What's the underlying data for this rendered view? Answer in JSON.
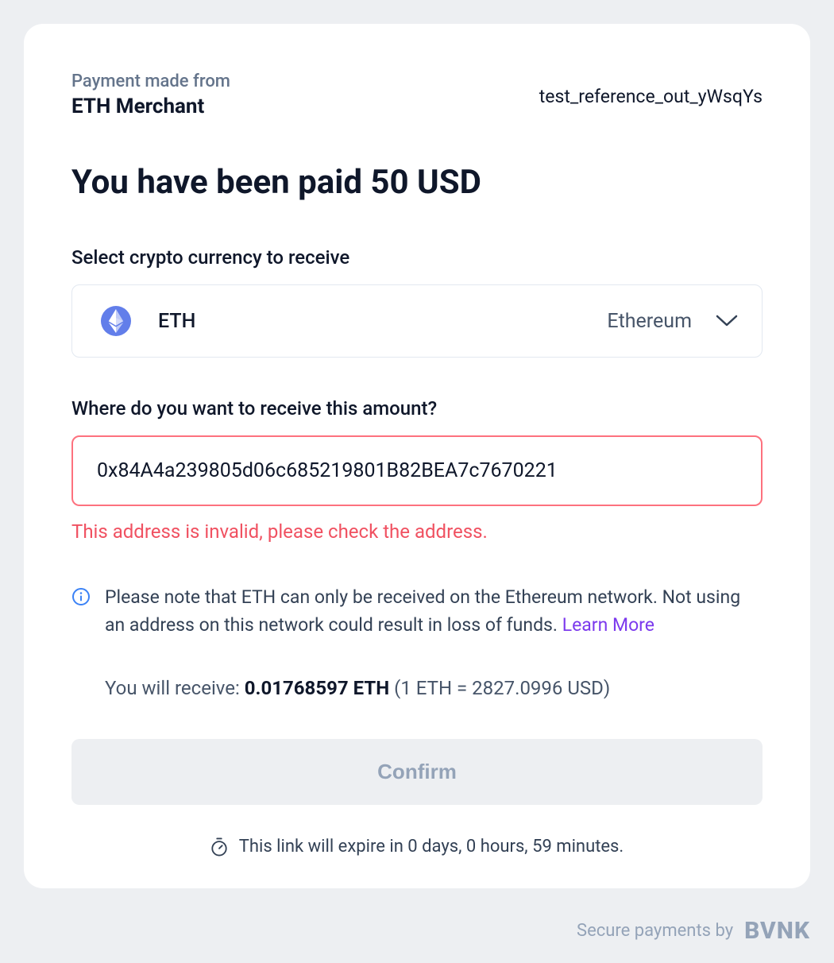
{
  "header": {
    "payment_from_label": "Payment made from",
    "merchant_name": "ETH Merchant",
    "reference": "test_reference_out_yWsqYs"
  },
  "title": "You have been paid 50 USD",
  "currency_select": {
    "label": "Select crypto currency to receive",
    "code": "ETH",
    "name": "Ethereum"
  },
  "address": {
    "label": "Where do you want to receive this amount?",
    "value": "0x84A4a239805d06c685219801B82BEA7c7670221",
    "error": "This address is invalid, please check the address."
  },
  "info": {
    "text": "Please note that ETH can only be received on the Ethereum network. Not using an address on this network could result in loss of funds. ",
    "learn_more": "Learn More"
  },
  "receive": {
    "label": "You will receive: ",
    "amount": "0.01768597 ETH",
    "rate": " (1 ETH = 2827.0996 USD)"
  },
  "confirm_label": "Confirm",
  "expire_text": "This link will expire in 0 days, 0 hours, 59 minutes.",
  "footer": {
    "secure_text": "Secure payments by",
    "brand": "BVNK"
  }
}
